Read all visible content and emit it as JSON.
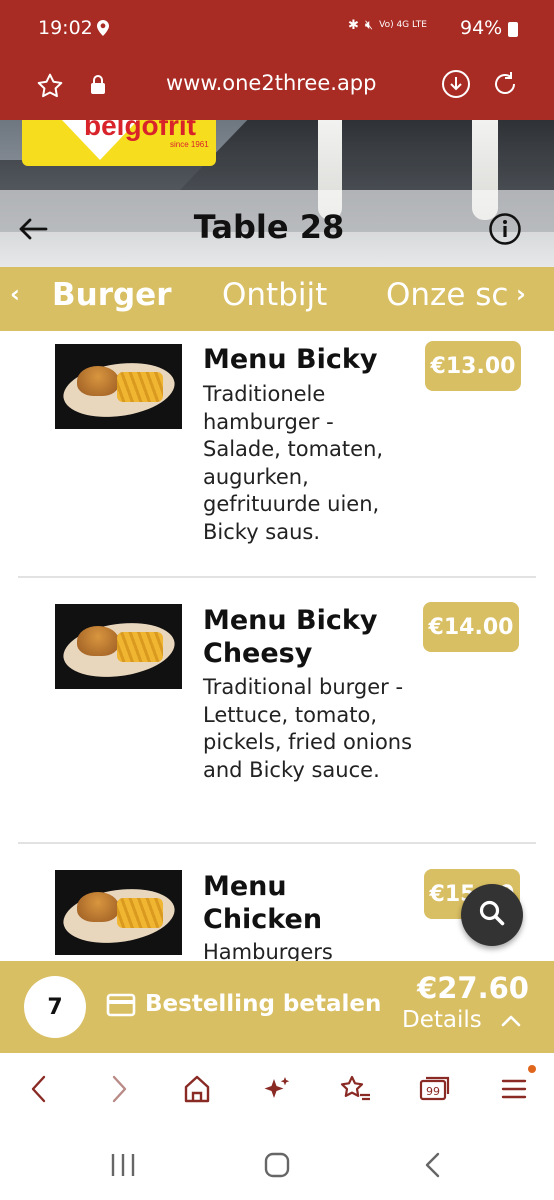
{
  "status": {
    "time": "19:02",
    "network": "Vo) 4G LTE",
    "battery": "94%"
  },
  "browser": {
    "url": "www.one2three.app"
  },
  "header": {
    "title": "Table 28",
    "logo_text": "belgofrit",
    "logo_sub": "since 1961"
  },
  "tabs": [
    {
      "label": "Burger",
      "active": true
    },
    {
      "label": "Ontbijt",
      "active": false
    },
    {
      "label": "Onze sc",
      "active": false
    }
  ],
  "items": [
    {
      "name": "Menu Bicky",
      "description": "Traditionele hamburger - Salade, tomaten, augurken, gefrituurde uien, Bicky saus.",
      "price": "€13.00"
    },
    {
      "name": "Menu Bicky Cheesy",
      "description": "Traditional burger - Lettuce, tomato, pickels, fried onions and Bicky sauce.",
      "price": "€14.00"
    },
    {
      "name": "Menu Chicken",
      "description": "Hamburgers",
      "price": "€15.00"
    }
  ],
  "order": {
    "count": "7",
    "label": "Bestelling betalen",
    "total": "€27.60",
    "details": "Details"
  },
  "colors": {
    "browser_bar": "#a82b24",
    "accent": "#d9bf63"
  }
}
